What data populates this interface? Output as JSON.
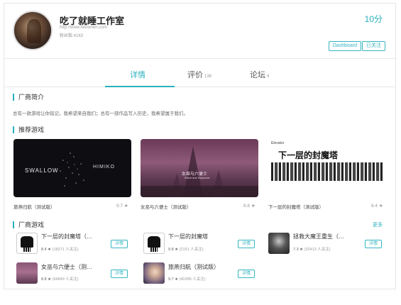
{
  "header": {
    "studio_name": "吃了就睡工作室",
    "url": "http://www.fatownen.com",
    "fans": "粉丝数:4163",
    "score": "10分",
    "dashboard_label": "Dashboard",
    "follow_label": "已关注"
  },
  "tabs": [
    {
      "label": "详情",
      "count": ""
    },
    {
      "label": "评价",
      "count": "138"
    },
    {
      "label": "论坛",
      "count": "4"
    }
  ],
  "intro": {
    "title": "厂商简介",
    "text": "总有一款游戏让你铭记，我希望来自我们；总有一部作品写入历史，我希望属于我们。"
  },
  "recommended": {
    "title": "推荐游戏",
    "items": [
      {
        "name": "旅燕归航（测试版）",
        "score": "9.7 ★",
        "art_left": "SWALLOW",
        "art_right": "HIMIKO"
      },
      {
        "name": "女巫与六便士（测试版）",
        "score": "8.8 ★",
        "art_caption": "女巫与六便士",
        "art_sub": "Witch and Sixpence"
      },
      {
        "name": "下一层的封魔塔（测试版）",
        "score": "8.4 ★",
        "art_title": "下一层的封魔塔",
        "art_tag": "Elevator"
      }
    ]
  },
  "games": {
    "title": "厂商游戏",
    "more_label": "更多",
    "detail_label": "详情",
    "items": [
      {
        "name": "下一层的封魔塔（…",
        "score": "8.4 ★",
        "followers": "(18271 人关注)",
        "icon": "pixel-tower-icon"
      },
      {
        "name": "下一层的封魔塔",
        "score": "9.8 ★",
        "followers": "(2151 人关注)",
        "icon": "pixel-tower-icon"
      },
      {
        "name": "拯救大魔王重生（…",
        "score": "7.3 ★",
        "followers": "(32413 人关注)",
        "icon": "dark-king-icon"
      },
      {
        "name": "女巫与六便士（测…",
        "score": "8.8 ★",
        "followers": "(64849 人关注)",
        "icon": "witch-icon"
      },
      {
        "name": "旅燕归航（测试版）",
        "score": "9.7 ★",
        "followers": "(40286 人关注)",
        "icon": "swallow-icon"
      }
    ]
  },
  "colors": {
    "accent": "#2ab0bd",
    "border": "#e6e6e6"
  }
}
